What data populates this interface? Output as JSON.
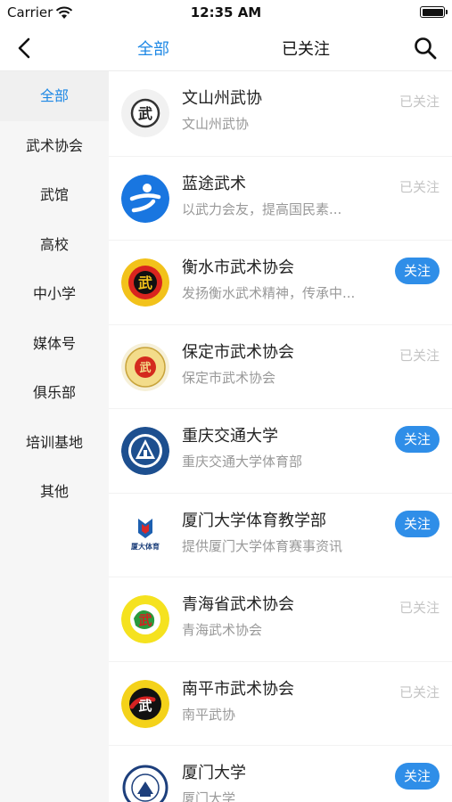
{
  "status_bar": {
    "carrier": "Carrier",
    "time": "12:35 AM"
  },
  "nav": {
    "tab_all": "全部",
    "tab_followed": "已关注"
  },
  "sidebar": {
    "items": [
      {
        "label": "全部"
      },
      {
        "label": "武术协会"
      },
      {
        "label": "武馆"
      },
      {
        "label": "高校"
      },
      {
        "label": "中小学"
      },
      {
        "label": "媒体号"
      },
      {
        "label": "俱乐部"
      },
      {
        "label": "培训基地"
      },
      {
        "label": "其他"
      }
    ]
  },
  "colors": {
    "accent": "#1e88e5",
    "follow_button": "#2f8ee8",
    "followed_text": "#c4c4c4"
  },
  "list": {
    "items": [
      {
        "name": "文山州武协",
        "desc": "文山州武协",
        "status": "已关注",
        "logo_text": "武"
      },
      {
        "name": "蓝途武术",
        "desc": "以武力会友，提高国民素...",
        "status": "已关注"
      },
      {
        "name": "衡水市武术协会",
        "desc": "发扬衡水武术精神，传承中...",
        "status": "关注",
        "logo_text": "武"
      },
      {
        "name": "保定市武术协会",
        "desc": "保定市武术协会",
        "status": "已关注",
        "logo_text": "武"
      },
      {
        "name": "重庆交通大学",
        "desc": "重庆交通大学体育部",
        "status": "关注"
      },
      {
        "name": "厦门大学体育教学部",
        "desc": "提供厦门大学体育赛事资讯",
        "status": "关注",
        "logo_text": "厦大体育"
      },
      {
        "name": "青海省武术协会",
        "desc": "青海武术协会",
        "status": "已关注",
        "logo_text": "武"
      },
      {
        "name": "南平市武术协会",
        "desc": "南平武协",
        "status": "已关注",
        "logo_text": "武"
      },
      {
        "name": "厦门大学",
        "desc": "厦门大学",
        "status": "关注"
      }
    ]
  }
}
